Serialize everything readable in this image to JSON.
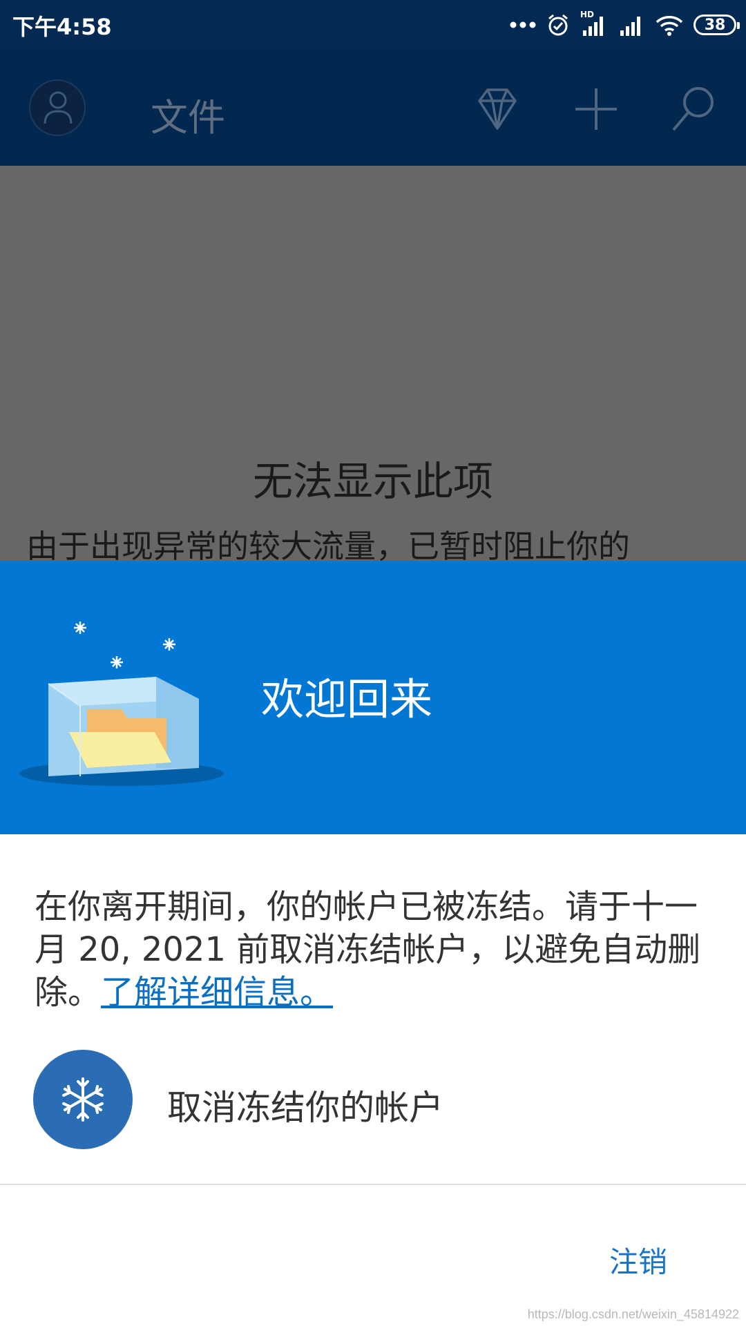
{
  "status_bar": {
    "time": "下午4:58",
    "network_label": "HD",
    "battery": "38"
  },
  "app_bar": {
    "title": "文件",
    "icons": [
      "avatar-icon",
      "diamond-icon",
      "plus-icon",
      "search-icon"
    ]
  },
  "background_content": {
    "error_title": "无法显示此项",
    "error_body": "由于出现异常的较大流量，已暂时阻止你的"
  },
  "dialog": {
    "header_title": "欢迎回来",
    "message_text": "在你离开期间，你的帐户已被冻结。请于十一月 20, 2021 前取消冻结帐户，以避免自动删除。",
    "learn_more_link": "了解详细信息。",
    "unfreeze_label": "取消冻结你的帐户",
    "signout_label": "注销"
  },
  "watermark": "https://blog.csdn.net/weixin_45814922",
  "colors": {
    "status_bar": "#042a53",
    "app_bar": "#03284f",
    "dialog_header": "#0277d4",
    "accent_link": "#0a6fc2",
    "unfreeze_circle": "#2a6db5"
  }
}
